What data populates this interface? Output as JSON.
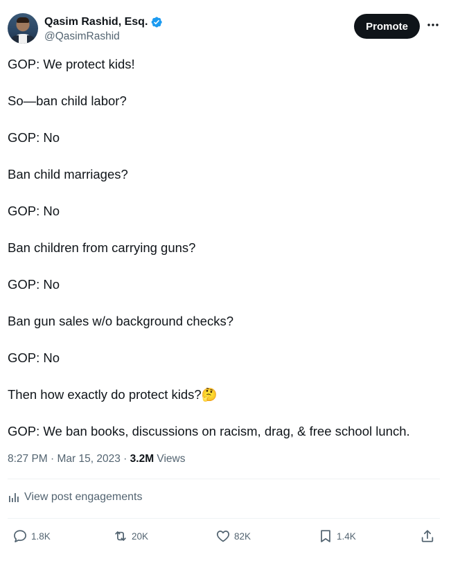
{
  "author": {
    "display_name": "Qasim Rashid, Esq.",
    "handle": "@QasimRashid",
    "verified_color": "#1d9bf0"
  },
  "header": {
    "promote_label": "Promote",
    "more_icon": "more-horizontal-icon"
  },
  "tweet": {
    "lines": [
      "GOP: We protect kids!",
      "So—ban child labor?",
      "GOP: No",
      "Ban child marriages?",
      "GOP: No",
      "Ban children from carrying guns?",
      "GOP: No",
      "Ban gun sales w/o background checks?",
      "GOP: No",
      "Then how exactly do protect kids?🤔",
      "GOP: We ban books, discussions on racism, drag, & free school lunch."
    ]
  },
  "meta": {
    "time": "8:27 PM",
    "date": "Mar 15, 2023",
    "separator": " · ",
    "views_count": "3.2M",
    "views_label": "Views"
  },
  "engagements": {
    "label": "View post engagements"
  },
  "actions": {
    "replies": "1.8K",
    "reposts": "20K",
    "likes": "82K",
    "bookmarks": "1.4K"
  },
  "colors": {
    "text": "#0f1419",
    "secondary": "#536471",
    "accent": "#1d9bf0",
    "button": "#0f1419"
  }
}
